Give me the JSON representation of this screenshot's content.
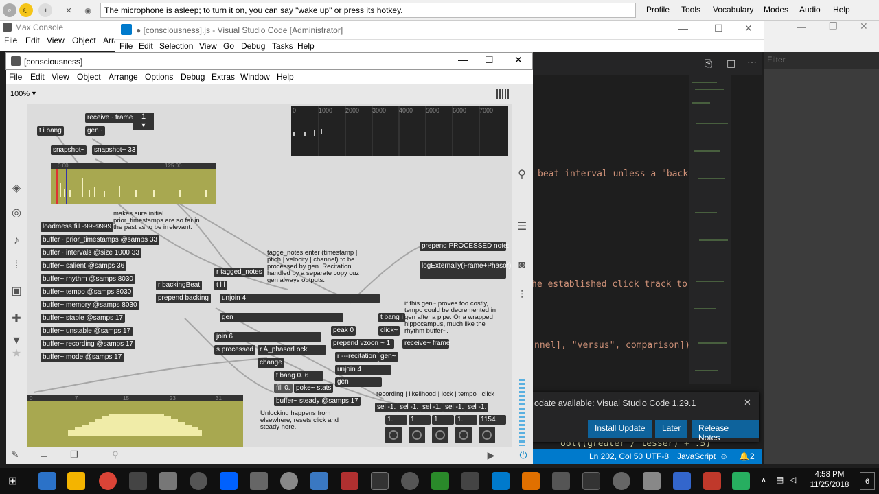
{
  "speech": {
    "text": "The microphone is asleep; to turn it on, you can say \"wake up\" or press its hotkey.",
    "menu": [
      "Profile",
      "Tools",
      "Vocabulary",
      "Modes",
      "Audio",
      "Help"
    ]
  },
  "max_console": {
    "title": "Max Console",
    "menu": [
      "File",
      "Edit",
      "View",
      "Object",
      "Arra"
    ]
  },
  "vscode": {
    "title": "● [consciousness].js - Visual Studio Code [Administrator]",
    "menu": [
      "File",
      "Edit",
      "Selection",
      "View",
      "Go",
      "Debug",
      "Tasks",
      "Help"
    ],
    "code_lines": [
      "beat interval unless a \"backing",
      "he established click track to wa",
      "nnel], \"versus\", comparison])",
      "ool((greater / lesser) + .5)"
    ],
    "update_message": "odate available: Visual Studio Code 1.29.1",
    "buttons": {
      "install": "Install Update",
      "later": "Later",
      "notes": "Release Notes"
    },
    "status": {
      "position": "Ln 202, Col 50",
      "encoding": "UTF-8",
      "language": "JavaScript",
      "notifications": "2"
    }
  },
  "right_panel": {
    "filter": "Filter"
  },
  "patcher": {
    "title": "[consciousness]",
    "menu": [
      "File",
      "Edit",
      "View",
      "Object",
      "Arrange",
      "Options",
      "Debug",
      "Extras",
      "Window",
      "Help"
    ],
    "zoom": "100%",
    "number_box": "1",
    "objects": [
      {
        "text": "receive~ frame"
      },
      {
        "text": "t i bang"
      },
      {
        "text": "gen~"
      },
      {
        "text": "snapshot~"
      },
      {
        "text": "snapshot~ 33"
      },
      {
        "text": "loadmess fill -9999999"
      },
      {
        "text": "buffer~ prior_timestamps @samps 33"
      },
      {
        "text": "buffer~ intervals @size 1000 33"
      },
      {
        "text": "buffer~ salient @samps 36"
      },
      {
        "text": "buffer~ rhythm @samps 8030"
      },
      {
        "text": "buffer~ tempo @samps 8030"
      },
      {
        "text": "buffer~ memory @samps 8030"
      },
      {
        "text": "buffer~ stable @samps 17"
      },
      {
        "text": "buffer~ unstable @samps 17"
      },
      {
        "text": "buffer~ recording @samps 17"
      },
      {
        "text": "buffer~ mode @samps 17"
      },
      {
        "text": "r backingBeat"
      },
      {
        "text": "prepend backing"
      },
      {
        "text": "r tagged_notes"
      },
      {
        "text": "t l l"
      },
      {
        "text": "unjoin 4"
      },
      {
        "text": "gen"
      },
      {
        "text": "join 6"
      },
      {
        "text": "s processed"
      },
      {
        "text": "r A_phasorLock"
      },
      {
        "text": "change"
      },
      {
        "text": "t bang 0. 6"
      },
      {
        "text": "fill 0."
      },
      {
        "text": "poke~ stats"
      },
      {
        "text": "buffer~ steady @samps 17"
      },
      {
        "text": "peak 0"
      },
      {
        "text": "prepend vzoom"
      },
      {
        "text": "r ---recitation"
      },
      {
        "text": "unjoin 4"
      },
      {
        "text": "gen"
      },
      {
        "text": "t bang i"
      },
      {
        "text": "click~"
      },
      {
        "text": "~ 1."
      },
      {
        "text": "receive~ frame"
      },
      {
        "text": "gen~"
      },
      {
        "text": "prepend PROCESSED note:"
      },
      {
        "text": "logExternally(Frame+Phasor)"
      },
      {
        "text": "sel -1."
      },
      {
        "text": "sel -1."
      },
      {
        "text": "sel -1."
      },
      {
        "text": "sel -1."
      },
      {
        "text": "sel -1."
      },
      {
        "text": "1."
      },
      {
        "text": "1"
      },
      {
        "text": "1"
      },
      {
        "text": "1."
      },
      {
        "text": "1154."
      }
    ],
    "comments": [
      "makes sure initial prior_timestamps are so far in the past as to be irrelevant.",
      "tagge_notes enter (timestamp | ptich | velocity | channel) to be processed by gen. Recitation handled by a separate copy cuz gen always outputs.",
      "if this gen~ proves too costly, tempo could be decremented in gen after a pipe. Or a wrapped hippocampus, much like the rhythm buffer~.",
      "recording | likelihood | lock | tempo | click",
      "Unlocking happens from elsewhere, resets click and steady here."
    ],
    "ruler_top": [
      "0",
      "1000",
      "2000",
      "3000",
      "4000",
      "5000",
      "6000",
      "7000"
    ],
    "waveform_marks": [
      "0.00",
      "125.00"
    ],
    "multislider_ticks": [
      "0",
      "7",
      "15",
      "23",
      "31"
    ]
  },
  "taskbar": {
    "time": "4:58 PM",
    "date": "11/25/2018",
    "badge": "6"
  },
  "colors": {
    "vscode_blue": "#007acc",
    "max_object": "#333333",
    "waveform_bg": "#a8a850",
    "multislider_bg": "#a8a850"
  }
}
